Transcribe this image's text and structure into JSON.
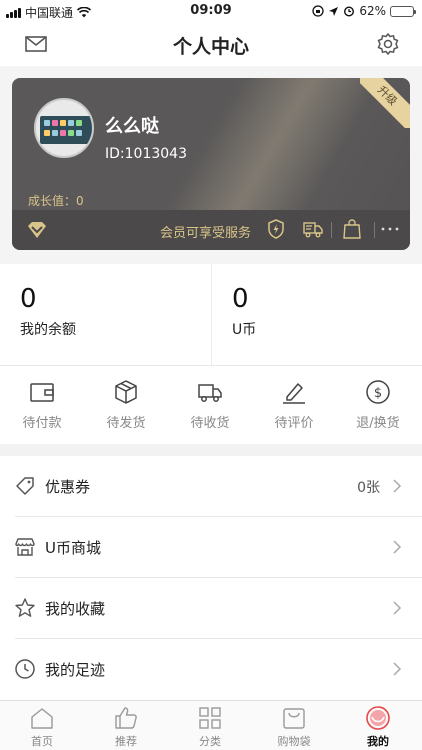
{
  "status_bar": {
    "carrier": "中国联通",
    "time": "09:09",
    "battery": "62%",
    "battery_level": 0.62
  },
  "nav": {
    "title": "个人中心",
    "left_icon": "mail-icon",
    "right_icon": "gear-icon"
  },
  "card": {
    "username": "么么哒",
    "user_id": "ID:1013043",
    "growth_label": "成长值：",
    "growth_value": "0",
    "upgrade_label": "升级",
    "service_label": "会员可享受服务",
    "gold": "#d9c58a"
  },
  "wallet": [
    {
      "value": "0",
      "label": "我的余额"
    },
    {
      "value": "0",
      "label": "U币"
    }
  ],
  "orders": [
    {
      "label": "待付款",
      "icon": "wallet-icon"
    },
    {
      "label": "待发货",
      "icon": "box-icon"
    },
    {
      "label": "待收货",
      "icon": "truck-icon"
    },
    {
      "label": "待评价",
      "icon": "pen-icon"
    },
    {
      "label": "退/换货",
      "icon": "dollar-circle-icon"
    }
  ],
  "menu": [
    {
      "label": "优惠券",
      "value": "0张",
      "icon": "tag-icon"
    },
    {
      "label": "U币商城",
      "value": "",
      "icon": "store-icon"
    },
    {
      "label": "我的收藏",
      "value": "",
      "icon": "star-icon"
    },
    {
      "label": "我的足迹",
      "value": "",
      "icon": "clock-icon"
    }
  ],
  "tabs": [
    {
      "label": "首页",
      "icon": "home-icon"
    },
    {
      "label": "推荐",
      "icon": "thumbs-up-icon"
    },
    {
      "label": "分类",
      "icon": "grid-icon"
    },
    {
      "label": "购物袋",
      "icon": "bag-icon"
    },
    {
      "label": "我的",
      "icon": "profile-icon",
      "active": true
    }
  ],
  "accent": "#e8474c"
}
